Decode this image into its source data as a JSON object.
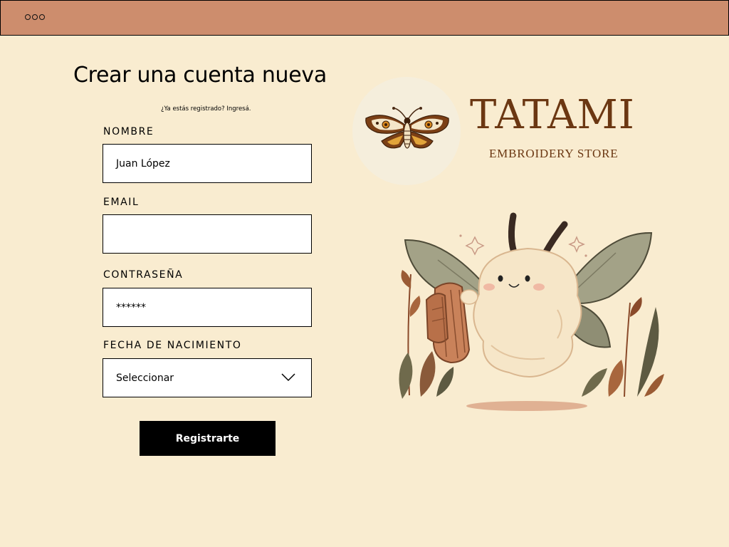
{
  "topbar": {
    "menu_icon": "three-dots-icon"
  },
  "form": {
    "title": "Crear una cuenta nueva",
    "login_prompt": "¿Ya estás registrado? Ingresá.",
    "fields": {
      "name": {
        "label": "NOMBRE",
        "value": "Juan López"
      },
      "email": {
        "label": "EMAIL",
        "value": ""
      },
      "password": {
        "label": "CONTRASEÑA",
        "value": "******"
      },
      "birthdate": {
        "label": "FECHA DE NACIMIENTO",
        "value": "Seleccionar",
        "icon": "chevron-down-icon"
      }
    },
    "submit_label": "Registrarte"
  },
  "brand": {
    "name": "TATAMI",
    "tagline": "EMBROIDERY STORE",
    "logo_icon": "moth-icon",
    "color": "#6b3712"
  },
  "illustration": {
    "name": "moth-mascot-holding-knitted-scarf"
  },
  "colors": {
    "background": "#f9ecd0",
    "topbar": "#cd8d6d",
    "button": "#000000",
    "button_text": "#ffffff"
  }
}
